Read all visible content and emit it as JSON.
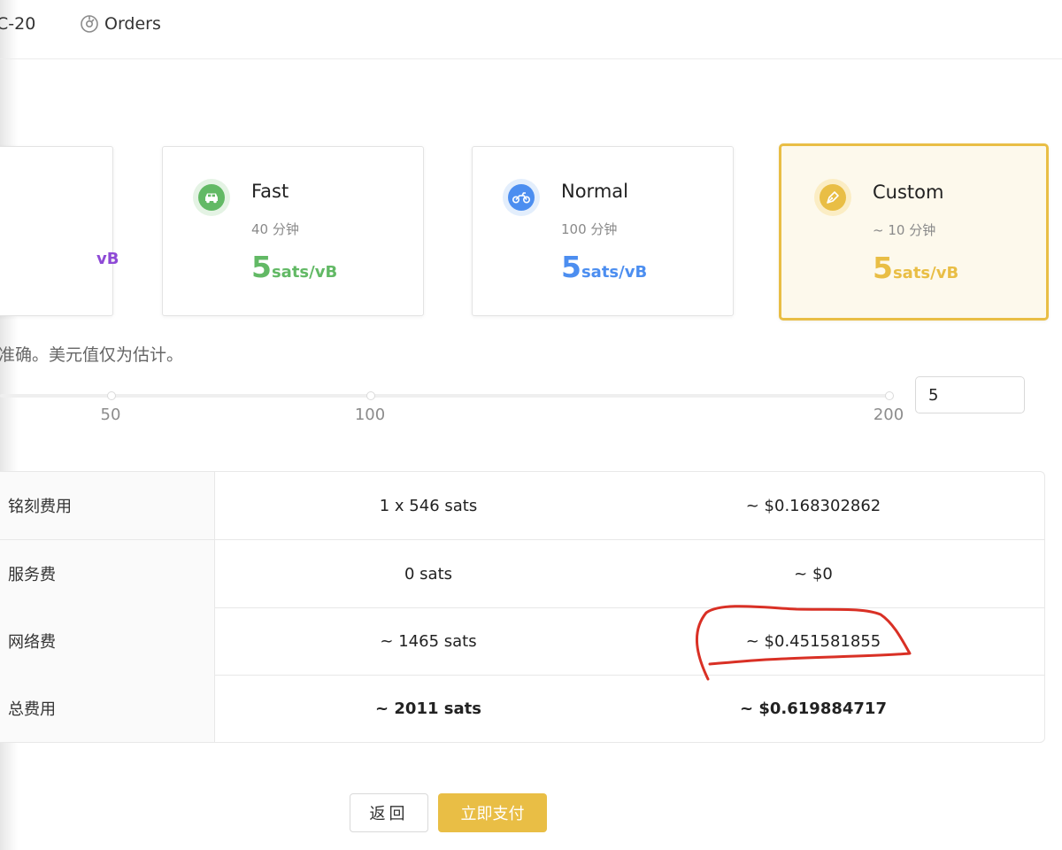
{
  "nav": {
    "items": [
      {
        "label": "C-20",
        "icon": "tag-icon"
      },
      {
        "label": "Orders",
        "icon": "orders-icon"
      }
    ]
  },
  "fee_cards": {
    "partial": {
      "unit": "vB",
      "color": "#8e4ad6"
    },
    "fast": {
      "title": "Fast",
      "eta": "40 分钟",
      "value": "5",
      "unit": "sats/vB",
      "color": "#62b965",
      "icon": "car-icon"
    },
    "normal": {
      "title": "Normal",
      "eta": "100 分钟",
      "value": "5",
      "unit": "sats/vB",
      "color": "#4c8ef0",
      "icon": "motorcycle-icon"
    },
    "custom": {
      "title": "Custom",
      "eta": "~ 10 分钟",
      "value": "5",
      "unit": "sats/vB",
      "color": "#e9be45",
      "icon": "pen-icon",
      "selected": true
    }
  },
  "note": "准确。美元值仅为估计。",
  "slider": {
    "marks": [
      "50",
      "100",
      "200"
    ],
    "input_value": "5"
  },
  "fee_table": {
    "rows": [
      {
        "label": "铭刻费用",
        "sats": "1 x 546 sats",
        "usd": "~ $0.168302862"
      },
      {
        "label": "服务费",
        "sats": "0 sats",
        "usd": "~ $0"
      },
      {
        "label": "网络费",
        "sats": "~ 1465 sats",
        "usd": "~ $0.451581855"
      },
      {
        "label": "总费用",
        "sats": "~ 2011 sats",
        "usd": "~ $0.619884717"
      }
    ]
  },
  "buttons": {
    "back": "返回",
    "pay": "立即支付"
  },
  "accent_color": "#e9be45",
  "annotation_color": "#d93025"
}
